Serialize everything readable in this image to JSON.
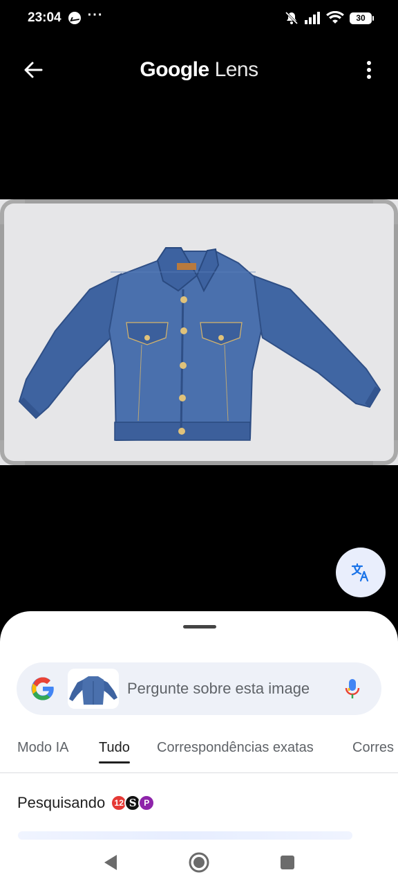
{
  "status_bar": {
    "time": "23:04",
    "notification_icons": [
      "messenger-icon",
      "more-dots-icon"
    ],
    "system_icons": [
      "mute-icon",
      "signal-icon",
      "wifi-icon"
    ],
    "battery": "30"
  },
  "app_bar": {
    "title_google": "Google",
    "title_lens": "Lens",
    "back_icon": "arrow-back-icon",
    "menu_icon": "more-vert-icon"
  },
  "image": {
    "subject": "denim jacket",
    "background_color": "#e6e6e8"
  },
  "translate_fab": {
    "icon": "translate-icon"
  },
  "sheet": {
    "search": {
      "placeholder": "Pergunte sobre esta image",
      "logo": "google-g-icon",
      "mic_icon": "mic-icon"
    },
    "tabs": [
      {
        "label": "Modo IA",
        "active": false
      },
      {
        "label": "Tudo",
        "active": true
      },
      {
        "label": "Correspondências exatas",
        "active": false
      },
      {
        "label": "Corres",
        "active": false
      }
    ],
    "searching_label": "Pesquisando",
    "badges": [
      "12",
      "S",
      "P"
    ]
  },
  "nav_bar": {
    "icons": [
      "back-triangle-icon",
      "home-circle-icon",
      "recents-square-icon"
    ]
  },
  "colors": {
    "accent_blue": "#1a73e8",
    "sheet_bg": "#ffffff",
    "search_bg": "#eef1f8",
    "fab_bg": "#e9eefc"
  }
}
